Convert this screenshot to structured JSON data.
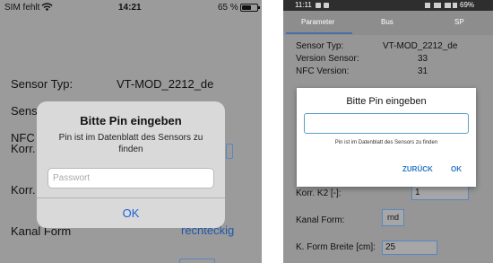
{
  "ios": {
    "status": {
      "carrier": "SIM fehlt",
      "time": "14:21",
      "battery_pct": "65 %"
    },
    "rows": {
      "sensor_typ_label": "Sensor Typ:",
      "sensor_typ_value": "VT-MOD_2212_de",
      "sens_label": "Sens",
      "nfc_label": "NFC",
      "korr_label": "Korr.",
      "korr2_label": "Korr.",
      "kanal_label": "Kanal Form",
      "kanal_value": "rechteckig"
    },
    "alert": {
      "title": "Bitte Pin eingeben",
      "message": "Pin ist im Datenblatt des Sensors zu finden",
      "placeholder": "Passwort",
      "ok": "OK"
    }
  },
  "android": {
    "status": {
      "time": "11:11",
      "battery_pct": "69%"
    },
    "tabs": [
      "Parameter",
      "Bus",
      "SP"
    ],
    "rows": {
      "sensor_typ_label": "Sensor Typ:",
      "sensor_typ_value": "VT-MOD_2212_de",
      "version_label": "Version Sensor:",
      "version_value": "33",
      "nfc_label": "NFC Version:",
      "nfc_value": "31",
      "korr2_label": "Korr. K2 [-]:",
      "korr2_value": "1",
      "kanal_label": "Kanal Form:",
      "kanal_value": "rnd",
      "breite_label": "K. Form Breite [cm]:",
      "breite_value": "25"
    },
    "dialog": {
      "title": "Bitte Pin eingeben",
      "hint": "Pin ist im Datenblatt des Sensors zu finden",
      "back": "ZURÜCK",
      "ok": "OK"
    }
  }
}
